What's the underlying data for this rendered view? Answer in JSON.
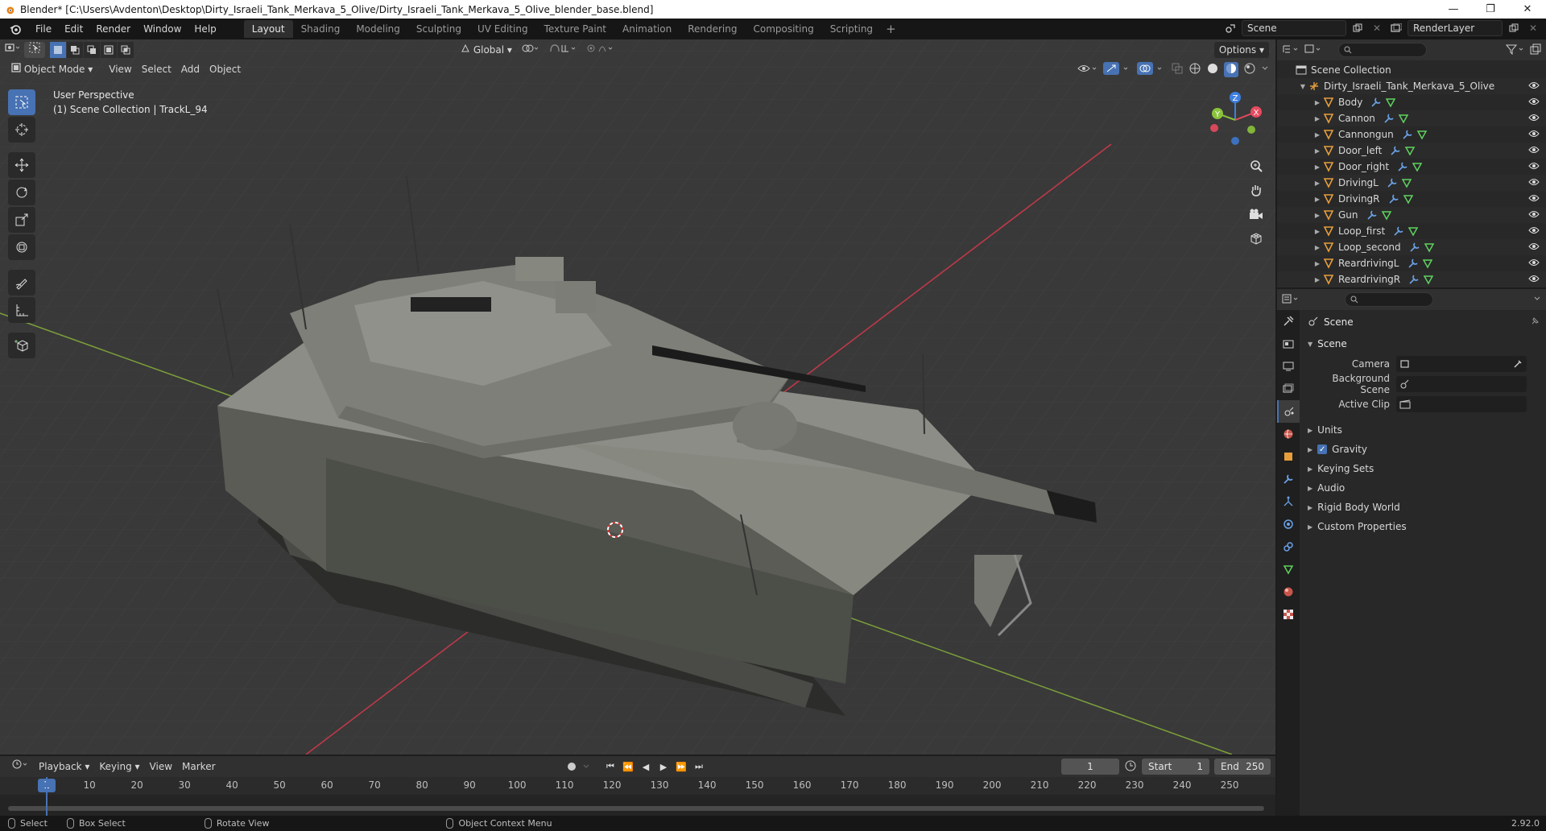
{
  "window": {
    "title": "Blender* [C:\\Users\\Avdenton\\Desktop\\Dirty_Israeli_Tank_Merkava_5_Olive/Dirty_Israeli_Tank_Merkava_5_Olive_blender_base.blend]",
    "controls": [
      "—",
      "❐",
      "✕"
    ]
  },
  "menu": [
    "File",
    "Edit",
    "Render",
    "Window",
    "Help"
  ],
  "workspaces": [
    "Layout",
    "Shading",
    "Modeling",
    "Sculpting",
    "UV Editing",
    "Texture Paint",
    "Animation",
    "Rendering",
    "Compositing",
    "Scripting"
  ],
  "workspace_add": "+",
  "scene_field": "Scene",
  "render_layer_field": "RenderLayer",
  "viewport": {
    "transform_orientation": "Global",
    "options": "Options",
    "mode": "Object Mode",
    "menus": [
      "View",
      "Select",
      "Add",
      "Object"
    ],
    "info_line1": "User Perspective",
    "info_line2": "(1) Scene Collection | TrackL_94",
    "gizmo": {
      "z": "Z",
      "x": "X",
      "y": "Y"
    }
  },
  "outliner": {
    "root": "Scene Collection",
    "collection": "Dirty_Israeli_Tank_Merkava_5_Olive",
    "items": [
      "Body",
      "Cannon",
      "Cannongun",
      "Door_left",
      "Door_right",
      "DrivingL",
      "DrivingR",
      "Gun",
      "Loop_first",
      "Loop_second",
      "ReardrivingL",
      "ReardrivingR"
    ]
  },
  "properties": {
    "context": "Scene",
    "panel": "Scene",
    "fields": [
      {
        "label": "Camera",
        "value": ""
      },
      {
        "label": "Background Scene",
        "value": ""
      },
      {
        "label": "Active Clip",
        "value": ""
      }
    ],
    "sections": [
      "Units",
      "Gravity",
      "Keying Sets",
      "Audio",
      "Rigid Body World",
      "Custom Properties"
    ]
  },
  "timeline": {
    "menus": [
      "Playback",
      "Keying",
      "View",
      "Marker"
    ],
    "current_frame": "1",
    "start_label": "Start",
    "start": "1",
    "end_label": "End",
    "end": "250",
    "ticks": [
      "1",
      "10",
      "20",
      "30",
      "40",
      "50",
      "60",
      "70",
      "80",
      "90",
      "100",
      "110",
      "120",
      "130",
      "140",
      "150",
      "160",
      "170",
      "180",
      "190",
      "200",
      "210",
      "220",
      "230",
      "240",
      "250"
    ]
  },
  "status": {
    "select": "Select",
    "box_select": "Box Select",
    "rotate_view": "Rotate View",
    "context_menu": "Object Context Menu",
    "version": "2.92.0"
  },
  "colors": {
    "accent": "#4772b3",
    "x_axis": "#e84a5f",
    "y_axis": "#8ac33b",
    "z_axis": "#3f7fe0",
    "mesh_icon": "#e69e3c"
  }
}
